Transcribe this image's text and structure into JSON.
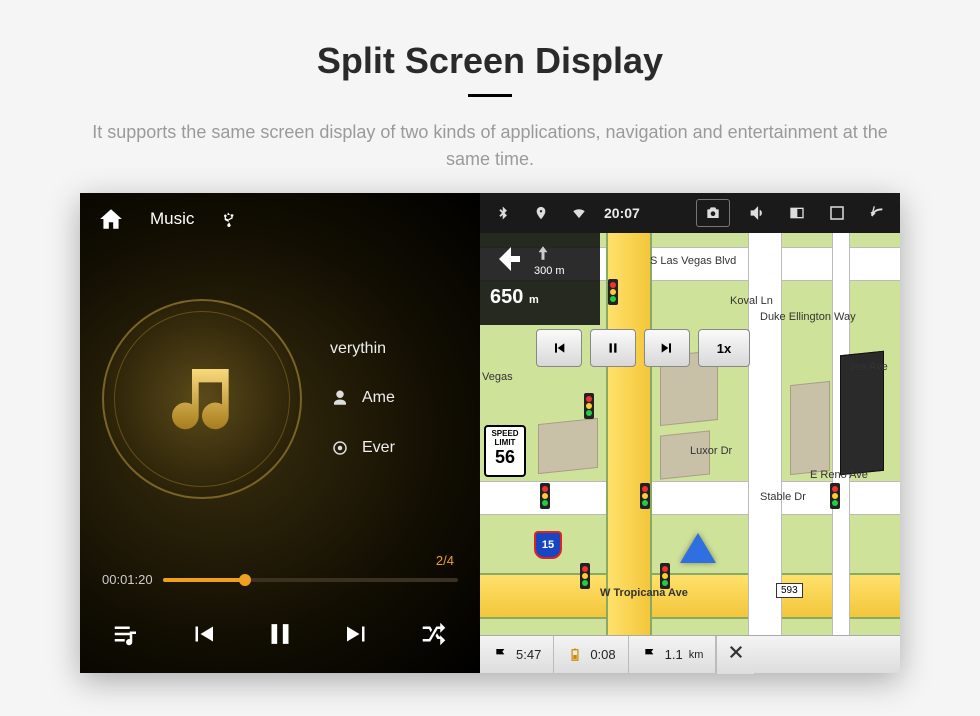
{
  "header": {
    "title": "Split Screen Display",
    "subtitle": "It supports the same screen display of two kinds of applications, navigation and entertainment at the same time."
  },
  "music": {
    "app_label": "Music",
    "tracks": [
      {
        "title": "verythin"
      },
      {
        "title": "Ame"
      },
      {
        "title": "Ever"
      }
    ],
    "track_index": "2/4",
    "elapsed": "00:01:20"
  },
  "status_bar": {
    "time": "20:07"
  },
  "nav": {
    "turn": {
      "next_distance_value": "300",
      "next_distance_unit": "m",
      "main_distance_value": "650",
      "main_distance_unit": "m"
    },
    "speed_limit": {
      "label1": "SPEED",
      "label2": "LIMIT",
      "value": "56"
    },
    "sim_speed": "1x",
    "interstate": "15",
    "exit_badge": "593",
    "streets": {
      "top": "S Las Vegas Blvd",
      "koval": "Koval Ln",
      "duke": "Duke Ellington Way",
      "vegas": "Vegas",
      "luxor": "Luxor Dr",
      "reno": "E Reno Ave",
      "stable": "Stable Dr",
      "trop": "W Tropicana Ave",
      "iles": "iles Ave"
    },
    "bottom": {
      "eta": "5:47",
      "dist1": "0:08",
      "dist2": "1.1",
      "dist2_unit": "km"
    }
  }
}
